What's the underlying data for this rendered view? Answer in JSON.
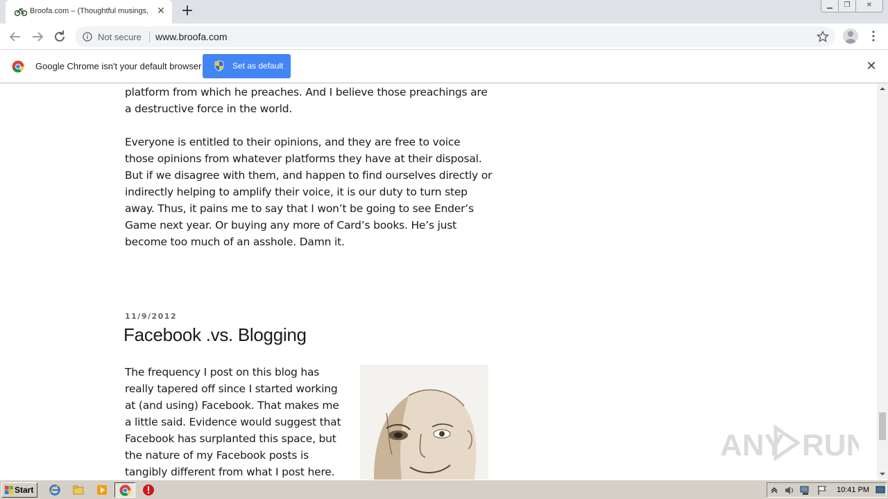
{
  "browser": {
    "tab": {
      "title": "Broofa.com – (Thoughtful musings, i",
      "favicon": "bicycle-icon"
    },
    "window_controls": [
      "minimize",
      "restore",
      "close"
    ],
    "address_bar": {
      "security_label": "Not secure",
      "url": "www.broofa.com"
    }
  },
  "infobar": {
    "message": "Google Chrome isn't your default browser",
    "button_label": "Set as default",
    "accent": "#4285f4"
  },
  "page": {
    "previous_post_paragraphs": [
      "platform from which he preaches.  And I believe those preachings are a destructive force in the world.",
      "Everyone is entitled to their opinions, and they are free to voice those opinions from whatever platforms they have at their disposal.  But if we disagree with them, and happen to find ourselves directly or indirectly helping to amplify their voice, it is our duty to turn step away.  Thus, it pains me to say that I won’t be going to see Ender’s Game next year.  Or buying any more of Card’s books.  He’s just become too much of an asshole.  Damn it."
    ],
    "post": {
      "date": "11/9/2012",
      "title": "Facebook .vs. Blogging",
      "body": "The frequency I post on this blog has really tapered off since I started working at (and using) Facebook.  That makes me a little said.  Evidence would suggest that Facebook has surplanted this space, but the nature of my Facebook posts is tangibly different from what I post here."
    },
    "watermark": "ANY RUN"
  },
  "taskbar": {
    "start_label": "Start",
    "clock": "10:41 PM"
  }
}
